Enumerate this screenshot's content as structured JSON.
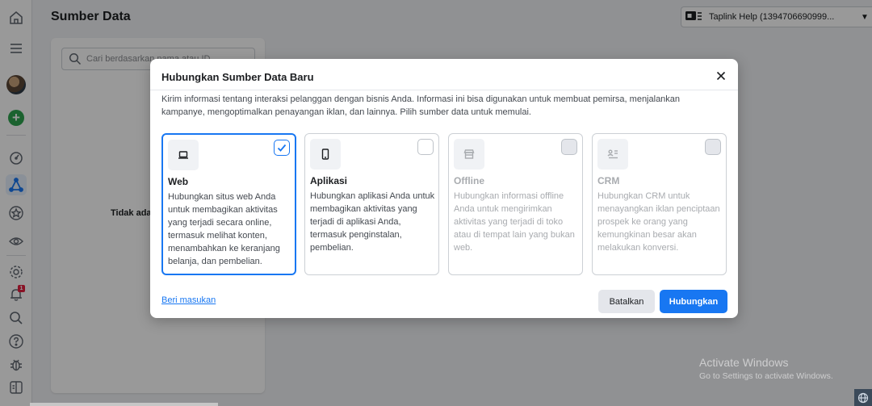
{
  "header": {
    "page_title": "Sumber Data",
    "account_label": "Taplink Help  (1394706690999..."
  },
  "sidebar": {
    "notification_count": "1"
  },
  "panel": {
    "search_placeholder": "Cari berdasarkan nama atau ID",
    "empty_text": "Tidak ada"
  },
  "modal": {
    "title": "Hubungkan Sumber Data Baru",
    "description": "Kirim informasi tentang interaksi pelanggan dengan bisnis Anda. Informasi ini bisa digunakan untuk membuat pemirsa, menjalankan kampanye, mengoptimalkan penayangan iklan, dan lainnya. Pilih sumber data untuk memulai.",
    "options": [
      {
        "title": "Web",
        "body": "Hubungkan situs web Anda untuk membagikan aktivitas yang terjadi secara online, termasuk melihat konten, menambahkan ke keranjang belanja, dan pembelian.",
        "icon": "laptop-icon",
        "selected": true,
        "disabled": false
      },
      {
        "title": "Aplikasi",
        "body": "Hubungkan aplikasi Anda untuk membagikan aktivitas yang terjadi di aplikasi Anda, termasuk penginstalan, pembelian.",
        "icon": "mobile-icon",
        "selected": false,
        "disabled": false
      },
      {
        "title": "Offline",
        "body": "Hubungkan informasi offline Anda untuk mengirimkan aktivitas yang terjadi di toko atau di tempat lain yang bukan web.",
        "icon": "store-icon",
        "selected": false,
        "disabled": true
      },
      {
        "title": "CRM",
        "body": "Hubungkan CRM untuk menayangkan iklan penciptaan prospek ke orang yang kemungkinan besar akan melakukan konversi.",
        "icon": "crm-icon",
        "selected": false,
        "disabled": true
      }
    ],
    "feedback_link": "Beri masukan",
    "cancel_label": "Batalkan",
    "connect_label": "Hubungkan"
  },
  "watermark": {
    "line1": "Activate Windows",
    "line2": "Go to Settings to activate Windows."
  },
  "colors": {
    "accent": "#1877f2",
    "notification": "#e41e3f"
  }
}
